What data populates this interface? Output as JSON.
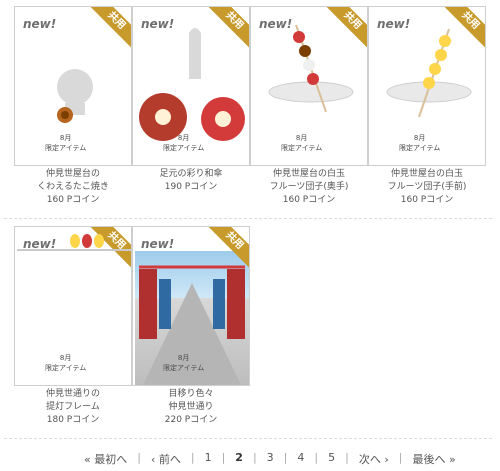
{
  "items": [
    {
      "new": "new!",
      "badge": "共用",
      "limited_line1": "8月",
      "limited_line2": "限定アイテム",
      "name1": "仲見世屋台の",
      "name2": "くわえるたこ焼き",
      "price": "160 Pコイン"
    },
    {
      "new": "new!",
      "badge": "共用",
      "limited_line1": "8月",
      "limited_line2": "限定アイテム",
      "name1": "足元の彩り和傘",
      "name2": "",
      "price": "190 Pコイン"
    },
    {
      "new": "new!",
      "badge": "共用",
      "limited_line1": "8月",
      "limited_line2": "限定アイテム",
      "name1": "仲見世屋台の白玉",
      "name2": "フルーツ団子(奥手)",
      "price": "160 Pコイン"
    },
    {
      "new": "new!",
      "badge": "共用",
      "limited_line1": "8月",
      "limited_line2": "限定アイテム",
      "name1": "仲見世屋台の白玉",
      "name2": "フルーツ団子(手前)",
      "price": "160 Pコイン"
    },
    {
      "new": "new!",
      "badge": "共用",
      "limited_line1": "8月",
      "limited_line2": "限定アイテム",
      "name1": "仲見世通りの",
      "name2": "提灯フレーム",
      "price": "180 Pコイン"
    },
    {
      "new": "new!",
      "badge": "共用",
      "limited_line1": "8月",
      "limited_line2": "限定アイテム",
      "name1": "目移り色々",
      "name2": "仲見世通り",
      "price": "220 Pコイン"
    }
  ],
  "pager": {
    "first": "« 最初へ",
    "prev": "‹ 前へ",
    "pages": [
      "1",
      "2",
      "3",
      "4",
      "5"
    ],
    "current": "2",
    "next": "次へ ›",
    "last": "最後へ »"
  }
}
